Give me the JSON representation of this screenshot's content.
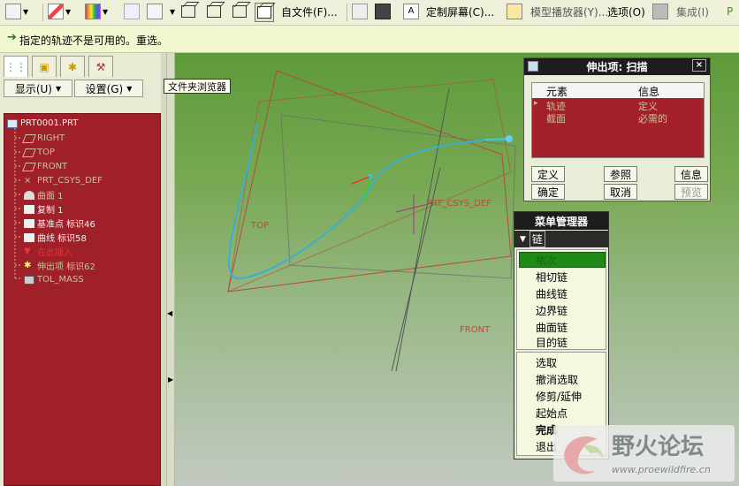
{
  "toolbar": {
    "file_label": "自文件(F)...",
    "custom_screen_label": "定制屏幕(C)...",
    "model_player_label": "模型播放器(Y)...",
    "options_label": "选项(O)",
    "integrate_label": "集成(I)",
    "cut_label": "P"
  },
  "message": {
    "text": "指定的轨迹不是可用的。重选。"
  },
  "tree_header": {
    "show_label": "显示(U)",
    "settings_label": "设置(G)",
    "tooltip": "文件夹浏览器"
  },
  "tree": {
    "items": [
      {
        "label": "PRT0001.PRT"
      },
      {
        "label": "RIGHT"
      },
      {
        "label": "TOP"
      },
      {
        "label": "FRONT"
      },
      {
        "label": "PRT_CSYS_DEF"
      },
      {
        "label": "曲面 1"
      },
      {
        "label": "复制 1"
      },
      {
        "label": "基准点 标识46"
      },
      {
        "label": "曲线 标识58"
      },
      {
        "label": "在此插入"
      },
      {
        "label": "伸出项 标识62"
      },
      {
        "label": "TOL_MASS"
      }
    ]
  },
  "viewport": {
    "labels": {
      "top": "TOP",
      "front": "FRONT",
      "csys": "PRT_CSYS_DEF"
    }
  },
  "dialog": {
    "title": "伸出项: 扫描",
    "close": "×",
    "columns": [
      "元素",
      "信息"
    ],
    "rows": [
      {
        "element": "轨迹",
        "info": "定义"
      },
      {
        "element": "截面",
        "info": "必需的"
      }
    ],
    "buttons": {
      "define": "定义",
      "refs": "参照",
      "info": "信息",
      "ok": "确定",
      "cancel": "取消",
      "preview": "预览"
    }
  },
  "menu_manager": {
    "title": "菜单管理器",
    "section": "链",
    "items": [
      "依次",
      "相切链",
      "曲线链",
      "边界链",
      "曲面链",
      "目的链"
    ],
    "actions": [
      "选取",
      "撤消选取",
      "修剪/延伸",
      "起始点",
      "完成",
      "退出"
    ]
  },
  "watermark": {
    "title": "野火论坛",
    "url": "www.proewildfire.cn"
  },
  "colors": {
    "tree_bg": "#a0202a",
    "menu_highlight": "#1f8a18",
    "curve": "#3ab0d0"
  }
}
